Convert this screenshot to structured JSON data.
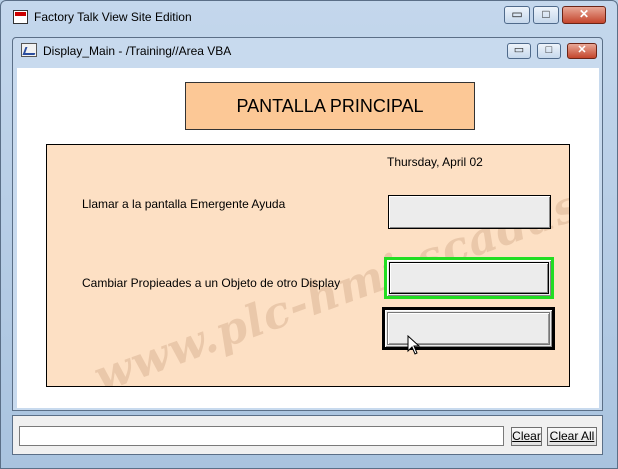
{
  "app": {
    "title": "Factory Talk View Site Edition",
    "controls": {
      "minimize": "▭",
      "maximize": "□",
      "close": "✕"
    }
  },
  "display_window": {
    "title": "Display_Main - /Training//Area VBA",
    "controls": {
      "minimize": "▭",
      "maximize": "□",
      "close": "✕"
    }
  },
  "display": {
    "header": "PANTALLA PRINCIPAL",
    "date": "Thursday, April 02",
    "label_help": "Llamar a la pantalla Emergente Ayuda",
    "label_change": "Cambiar Propieades a un Objeto de otro Display",
    "watermark": "www.plc-hmi-scadas.com",
    "colors": {
      "header_bg": "#fcc896",
      "panel_bg": "#fde0c4",
      "focus_border": "#22dd22"
    }
  },
  "message_bar": {
    "value": "",
    "clear_label": "Clear",
    "clear_all_label": "Clear All"
  }
}
